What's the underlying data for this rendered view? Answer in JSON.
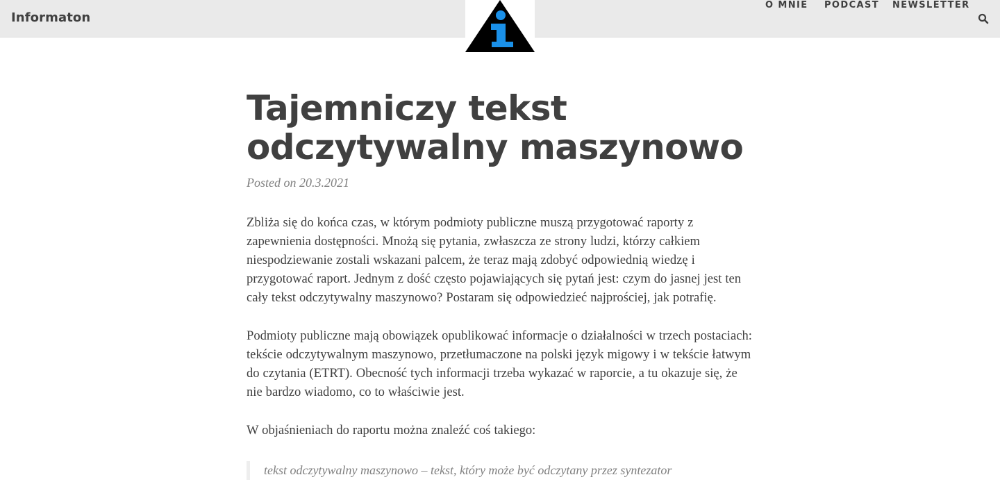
{
  "header": {
    "brand": "Informaton",
    "logo": {
      "icon": "info-triangle-logo",
      "triangle_color": "#000000",
      "info_color": "#1a90e8"
    },
    "nav": [
      {
        "label": "O MNIE"
      },
      {
        "label": "PODCAST"
      },
      {
        "label": "NEWSLETTER"
      }
    ],
    "search_icon": "search-icon"
  },
  "post": {
    "title_line1": "Tajemniczy tekst",
    "title_line2": "odczytywalny maszynowo",
    "meta": "Posted on 20.3.2021",
    "paragraphs": [
      "Zbliża się do końca czas, w którym podmioty publiczne muszą przygotować raporty z zapewnienia dostępności. Mnożą się pytania, zwłaszcza ze strony ludzi, którzy całkiem niespodziewanie zostali wskazani palcem, że teraz mają zdobyć odpowiednią wiedzę i przygotować raport. Jednym z dość często pojawiających się pytań jest: czym do jasnej jest ten cały tekst odczytywalny maszynowo? Postaram się odpowiedzieć najprościej, jak potrafię.",
      "Podmioty publiczne mają obowiązek opublikować informacje o działalności w trzech postaciach: tekście odczytywalnym maszynowo, przetłumaczone na polski język migowy i w tekście łatwym do czytania (ETRT). Obecność tych informacji trzeba wykazać w raporcie, a tu okazuje się, że nie bardzo wiadomo, co to właściwie jest.",
      "W objaśnieniach do raportu można znaleźć coś takiego:"
    ],
    "quote": "tekst odczytywalny maszynowo – tekst, który może być odczytany przez syntezator"
  }
}
